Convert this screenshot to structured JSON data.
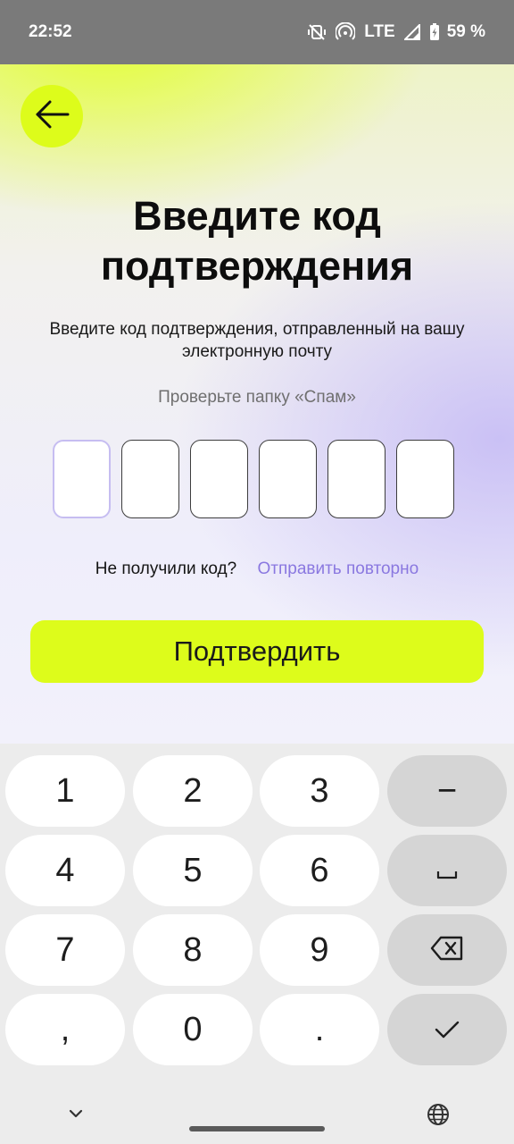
{
  "status_bar": {
    "time": "22:52",
    "network": "LTE",
    "battery": "59 %",
    "icons": [
      "vibrate-off-icon",
      "hotspot-icon",
      "signal-icon",
      "battery-charging-icon"
    ]
  },
  "header": {
    "back_icon": "arrow-left-icon"
  },
  "content": {
    "title": "Введите код подтверждения",
    "subtitle": "Введите код подтверждения, отправленный на вашу электронную почту",
    "hint": "Проверьте папку «Спам»",
    "code_digits": [
      "",
      "",
      "",
      "",
      "",
      ""
    ],
    "resend_question": "Не получили код?",
    "resend_link": "Отправить повторно",
    "confirm_label": "Подтвердить"
  },
  "keyboard": {
    "rows": [
      [
        "1",
        "2",
        "3",
        "−"
      ],
      [
        "4",
        "5",
        "6",
        "␣"
      ],
      [
        "7",
        "8",
        "9",
        "⌫"
      ],
      [
        ",",
        "0",
        ".",
        "✓"
      ]
    ],
    "bottom_left_icon": "chevron-down-icon",
    "bottom_right_icon": "globe-icon"
  },
  "colors": {
    "accent": "#ddfc1b",
    "link": "#8a78e0",
    "active_cell_border": "#c6bdf1",
    "status_bar": "#7a7a7a"
  }
}
